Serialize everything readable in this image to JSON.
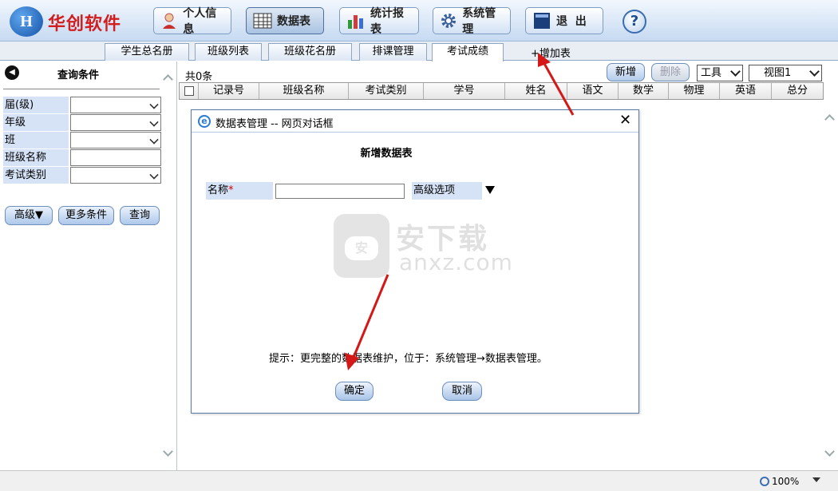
{
  "header": {
    "logo_text": "H",
    "brand": "华创软件",
    "nav": [
      {
        "label": "个人信息",
        "icon": "user-icon"
      },
      {
        "label": "数据表",
        "icon": "table-grid-icon"
      },
      {
        "label": "统计报表",
        "icon": "bar-chart-icon"
      },
      {
        "label": "系统管理",
        "icon": "gear-icon"
      },
      {
        "label": "退  出",
        "icon": "exit-icon"
      }
    ],
    "help_label": "?"
  },
  "tabs": [
    "学生总名册",
    "班级列表",
    "班级花名册",
    "排课管理",
    "考试成绩"
  ],
  "active_tab": "考试成绩",
  "add_tab_label": "+增加表",
  "left_panel": {
    "title": "查询条件",
    "fields": [
      {
        "label": "届(级)",
        "type": "select",
        "value": ""
      },
      {
        "label": "年级",
        "type": "select",
        "value": ""
      },
      {
        "label": "班",
        "type": "select",
        "value": ""
      },
      {
        "label": "班级名称",
        "type": "input",
        "value": ""
      },
      {
        "label": "考试类别",
        "type": "select",
        "value": ""
      }
    ],
    "buttons": {
      "advanced": "高级▼",
      "more": "更多条件",
      "query": "查询"
    }
  },
  "main": {
    "count_text": "共0条",
    "toolbar": {
      "new": "新增",
      "delete": "删除",
      "tools_select": "工具",
      "view_select": "视图1"
    },
    "columns": [
      "记录号",
      "班级名称",
      "考试类别",
      "学号",
      "姓名",
      "语文",
      "数学",
      "物理",
      "英语",
      "总分"
    ]
  },
  "dialog": {
    "title": "数据表管理 -- 网页对话框",
    "heading": "新增数据表",
    "name_label": "名称",
    "required_mark": "*",
    "name_value": "",
    "advanced_label": "高级选项",
    "hint": "提示：更完整的数据表维护，位于：系统管理→数据表管理。",
    "ok": "确定",
    "cancel": "取消",
    "close": "✕"
  },
  "watermark": {
    "badge": "安",
    "cn": "安下载",
    "en": "anxz.com"
  },
  "status": {
    "zoom": "100%"
  },
  "colors": {
    "brand_red": "#d21e1e",
    "label_bg": "#d6e3f7",
    "arrow_red": "#d41818"
  }
}
